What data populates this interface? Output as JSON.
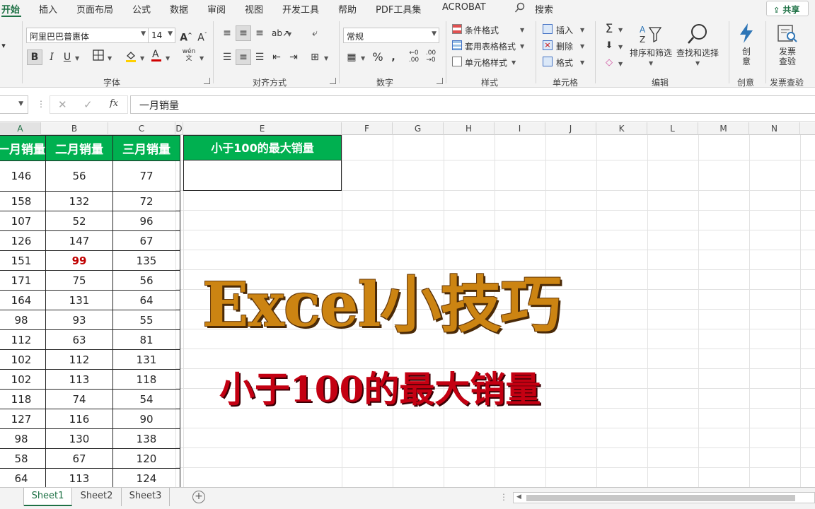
{
  "tabs": [
    "开始",
    "插入",
    "页面布局",
    "公式",
    "数据",
    "审阅",
    "视图",
    "开发工具",
    "帮助",
    "PDF工具集",
    "ACROBAT"
  ],
  "search_label": "搜索",
  "share_label": "共享",
  "font": {
    "name": "阿里巴巴普惠体",
    "size": "14",
    "bold": "B",
    "italic": "I",
    "underline": "U",
    "wen": "wén"
  },
  "number_format": "常规",
  "styles": {
    "conditional": "条件格式",
    "table": "套用表格格式",
    "cell": "单元格样式"
  },
  "cells_group": {
    "insert": "插入",
    "delete": "删除",
    "format": "格式"
  },
  "editing": {
    "sort": "排序和筛选",
    "find": "查找和选择"
  },
  "creative": {
    "line1": "创",
    "line2": "意"
  },
  "invoice": {
    "line1": "发票",
    "line2": "查验"
  },
  "group_labels": {
    "font": "字体",
    "alignment": "对齐方式",
    "number": "数字",
    "styles": "样式",
    "cells": "单元格",
    "editing": "编辑",
    "creative": "创意",
    "invoice": "发票查验"
  },
  "formula_bar": {
    "fx": "fx",
    "content": "一月销量"
  },
  "columns": [
    "A",
    "B",
    "C",
    "D",
    "E",
    "F",
    "G",
    "H",
    "I",
    "J",
    "K",
    "L",
    "M",
    "N"
  ],
  "table": {
    "headers": [
      "一月销量",
      "二月销量",
      "三月销量"
    ],
    "rows": [
      [
        "146",
        "56",
        "77"
      ],
      [
        "158",
        "132",
        "72"
      ],
      [
        "107",
        "52",
        "96"
      ],
      [
        "126",
        "147",
        "67"
      ],
      [
        "151",
        "99",
        "135"
      ],
      [
        "171",
        "75",
        "56"
      ],
      [
        "164",
        "131",
        "64"
      ],
      [
        "98",
        "93",
        "55"
      ],
      [
        "112",
        "63",
        "81"
      ],
      [
        "102",
        "112",
        "131"
      ],
      [
        "102",
        "113",
        "118"
      ],
      [
        "118",
        "74",
        "54"
      ],
      [
        "127",
        "116",
        "90"
      ],
      [
        "98",
        "130",
        "138"
      ],
      [
        "58",
        "67",
        "120"
      ],
      [
        "64",
        "113",
        "124"
      ]
    ],
    "highlight_color": "#c00000"
  },
  "result": {
    "header": "小于100的最大销量",
    "value": ""
  },
  "overlay": {
    "title": "Excel小技巧",
    "subtitle": "小于100的最大销量"
  },
  "sheets": [
    "Sheet1",
    "Sheet2",
    "Sheet3"
  ],
  "colors": {
    "accent": "#1e7145",
    "header_fill": "#00b050",
    "title_gold": "#cc8412",
    "subtitle_red": "#c40012"
  }
}
